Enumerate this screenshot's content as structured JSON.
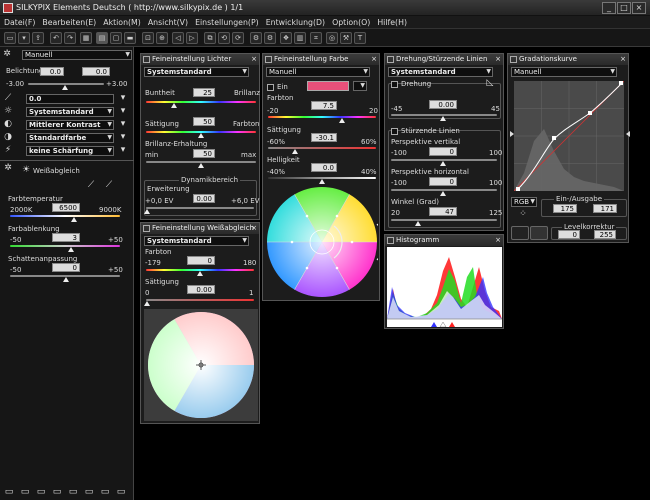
{
  "window": {
    "title": "SILKYPIX Elements Deutsch ( http://www.silkypix.de )   1/1"
  },
  "menu": [
    "Datei(F)",
    "Bearbeiten(E)",
    "Aktion(M)",
    "Ansicht(V)",
    "Einstellungen(P)",
    "Entwicklung(D)",
    "Option(O)",
    "Hilfe(H)"
  ],
  "left": {
    "preset": "Manuell",
    "exposure_label": "Belichtung",
    "exposure_v1": "0.0",
    "exposure_v2": "0.0",
    "exp_min": "-3.00",
    "exp_max": "+3.00",
    "wb_field": "0.0",
    "tone": "Systemstandard",
    "contrast": "Mittlerer Kontrast",
    "color": "Standardfarbe",
    "sharp": "keine Schärfung",
    "wb_label": "Weißabgleich",
    "temp_label": "Farbtemperatur",
    "temp_min": "2000K",
    "temp_val": "6500",
    "temp_max": "9000K",
    "tint_label": "Farbablenkung",
    "tint_min": "-50",
    "tint_val": "3",
    "tint_max": "+50",
    "shadow_label": "Schattenanpassung",
    "shadow_min": "-50",
    "shadow_val": "0",
    "shadow_max": "+50"
  },
  "lights": {
    "title": "Feineinstellung Lichter",
    "preset": "Systemstandard",
    "bri_label": "Buntheit",
    "bri_val": "25",
    "bri_right": "Brillanz",
    "sat_label": "Sättigung",
    "sat_val": "50",
    "sat_right": "Farbton",
    "keep_label": "Brillanz-Erhaltung",
    "keep_min": "min",
    "keep_val": "50",
    "keep_max": "max",
    "dyn_group": "Dynamikbereich",
    "ext_label": "Erweiterung",
    "ext_min": "+0,0 EV",
    "ext_val": "0.00",
    "ext_max": "+6,0 EV"
  },
  "wbfine": {
    "title": "Feineinstellung Weißabgleich",
    "preset": "Systemstandard",
    "hue_label": "Farbton",
    "hue_min": "-179",
    "hue_val": "0",
    "hue_max": "180",
    "sat_label": "Sättigung",
    "sat_val": "0.00",
    "sat_min": "0",
    "sat_max": "1"
  },
  "color": {
    "title": "Feineinstellung Farbe",
    "preset": "Manuell",
    "on_label": "Ein",
    "swatch": "#e8507a",
    "hue_label": "Farbton",
    "hue_min": "-20",
    "hue_val": "7.5",
    "hue_max": "20",
    "sat_label": "Sättigung",
    "sat_min": "-60%",
    "sat_val": "-30.1",
    "sat_max": "60%",
    "light_label": "Helligkeit",
    "light_min": "-40%",
    "light_val": "0.0",
    "light_max": "40%"
  },
  "rotate": {
    "title": "Drehung/Stürzende Linien",
    "preset": "Systemstandard",
    "rot_label": "Drehung",
    "rot_min": "-45",
    "rot_val": "0.00",
    "rot_max": "45",
    "persp_label": "Stürzende Linien",
    "pv_label": "Perspektive vertikal",
    "pv_min": "-100",
    "pv_val": "0",
    "pv_max": "100",
    "ph_label": "Perspektive horizontal",
    "ph_min": "-100",
    "ph_val": "0",
    "ph_max": "100",
    "ang_label": "Winkel (Grad)",
    "ang_min": "20",
    "ang_val": "47",
    "ang_max": "125"
  },
  "histogram": {
    "title": "Histogramm"
  },
  "curve": {
    "title": "Gradationskurve",
    "preset": "Manuell",
    "channel": "RGB",
    "io_group": "Ein-/Ausgabe",
    "in_val": "175",
    "out_val": "171",
    "level_group": "Levelkorrektur",
    "lvl_min": "0",
    "lvl_max": "255"
  }
}
